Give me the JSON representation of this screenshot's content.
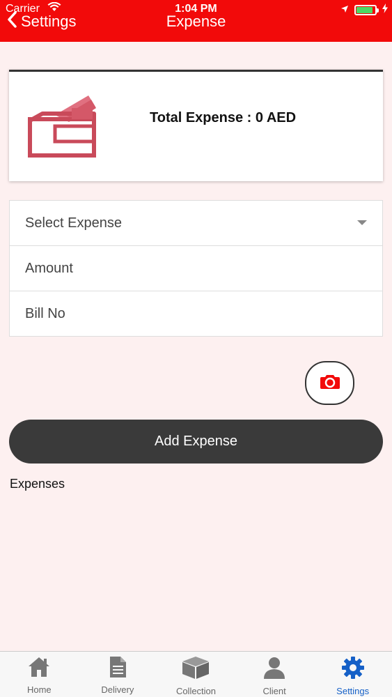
{
  "status": {
    "carrier": "Carrier",
    "time": "1:04 PM",
    "battery_percent": 90
  },
  "nav": {
    "back_label": "Settings",
    "title": "Expense"
  },
  "summary": {
    "total_text": "Total Expense : 0 AED"
  },
  "form": {
    "select_expense_placeholder": "Select Expense",
    "amount_placeholder": "Amount",
    "bill_no_placeholder": "Bill No",
    "amount_value": "",
    "bill_no_value": ""
  },
  "actions": {
    "add_expense_label": "Add Expense"
  },
  "expenses": {
    "section_label": "Expenses"
  },
  "tabbar": {
    "items": [
      {
        "label": "Home",
        "icon": "home-icon"
      },
      {
        "label": "Delivery",
        "icon": "document-icon"
      },
      {
        "label": "Collection",
        "icon": "box-icon"
      },
      {
        "label": "Client",
        "icon": "person-icon"
      },
      {
        "label": "Settings",
        "icon": "gear-icon"
      }
    ],
    "active_index": 4
  },
  "colors": {
    "header": "#f20a0a",
    "background": "#fdf0f0",
    "button": "#3a3a3a",
    "active_tab": "#1560c7",
    "wallet": "#c94a5a"
  }
}
